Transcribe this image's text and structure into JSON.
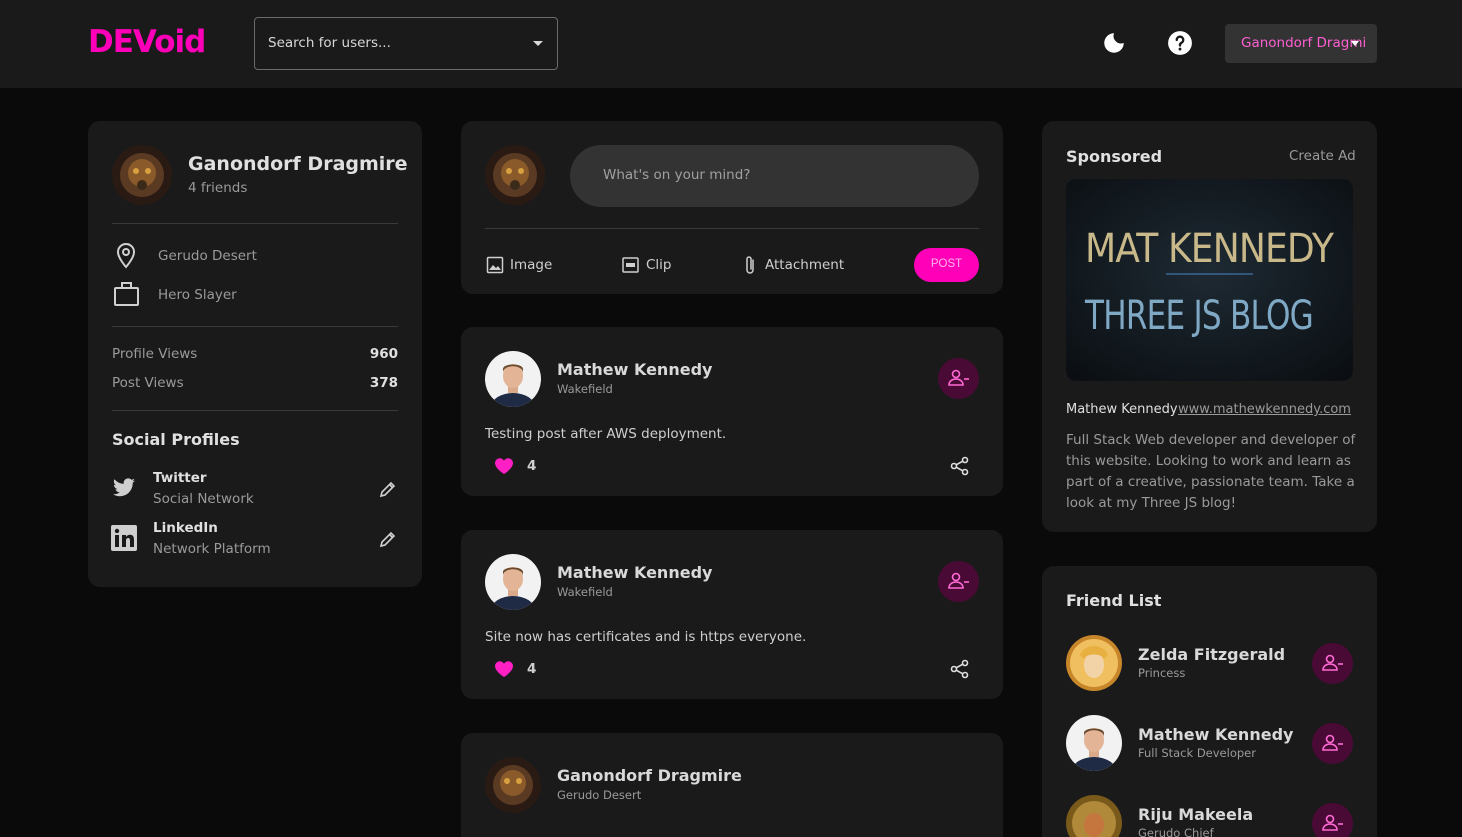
{
  "app": {
    "logo": "DEVoid"
  },
  "navbar": {
    "search_placeholder": "Search for users...",
    "user_name": "Ganondorf Dragmi",
    "icons": [
      "moon-icon",
      "help-icon"
    ]
  },
  "profile": {
    "name": "Ganondorf Dragmire",
    "friends": "4 friends",
    "location": "Gerudo Desert",
    "occupation": "Hero Slayer",
    "stats": [
      {
        "label": "Profile Views",
        "value": "960"
      },
      {
        "label": "Post Views",
        "value": "378"
      }
    ],
    "social_heading": "Social Profiles",
    "socials": [
      {
        "name": "Twitter",
        "type": "Social Network"
      },
      {
        "name": "LinkedIn",
        "type": "Network Platform"
      }
    ]
  },
  "composer": {
    "placeholder": "What's on your mind?",
    "actions": [
      "Image",
      "Clip",
      "Attachment"
    ],
    "post_label": "POST"
  },
  "posts": [
    {
      "author": "Mathew Kennedy",
      "location": "Wakefield",
      "text": "Testing post after AWS deployment.",
      "likes": "4"
    },
    {
      "author": "Mathew Kennedy",
      "location": "Wakefield",
      "text": "Site now has certificates and is https everyone.",
      "likes": "4"
    },
    {
      "author": "Ganondorf Dragmire",
      "location": "Gerudo Desert"
    }
  ],
  "sponsored": {
    "heading": "Sponsored",
    "create_ad": "Create Ad",
    "ad_line1": "MAT KENNEDY",
    "ad_line2": "THREE JS BLOG",
    "advertiser": "Mathew Kennedy",
    "url": "www.mathewkennedy.com",
    "description": "Full Stack Web developer and developer of this website. Looking to work and learn as part of a creative, passionate team. Take a look at my Three JS blog!"
  },
  "friend_list": {
    "heading": "Friend List",
    "friends": [
      {
        "name": "Zelda Fitzgerald",
        "role": "Princess"
      },
      {
        "name": "Mathew Kennedy",
        "role": "Full Stack Developer"
      },
      {
        "name": "Riju Makeela",
        "role": "Gerudo Chief"
      }
    ]
  },
  "colors": {
    "accent": "#ff00b8",
    "card": "#1a1a1a",
    "background": "#0a0a0a"
  }
}
